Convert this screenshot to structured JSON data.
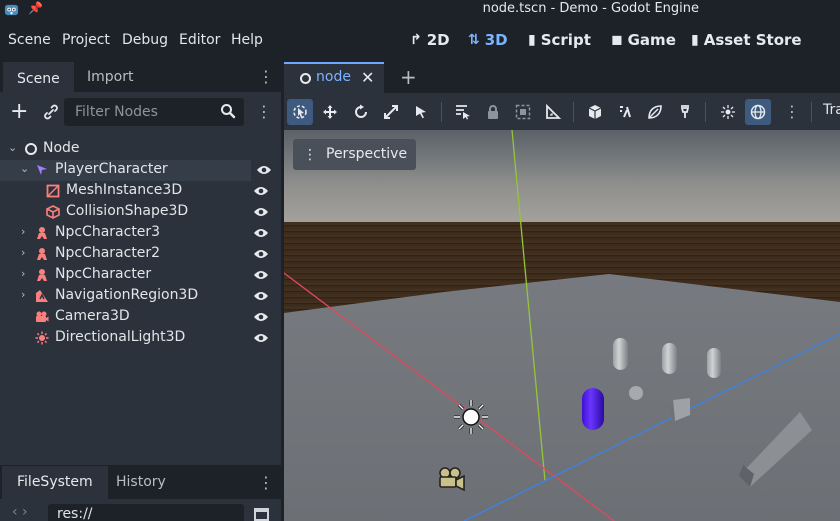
{
  "window": {
    "title": "node.tscn - Demo - Godot Engine"
  },
  "menu": [
    "Scene",
    "Project",
    "Debug",
    "Editor",
    "Help"
  ],
  "main_buttons": [
    {
      "label": "2D",
      "icon": "2d-icon",
      "active": false
    },
    {
      "label": "3D",
      "icon": "3d-icon",
      "active": true
    },
    {
      "label": "Script",
      "icon": "script-icon",
      "active": false
    },
    {
      "label": "Game",
      "icon": "game-icon",
      "active": false
    },
    {
      "label": "Asset Store",
      "icon": "asset-store-icon",
      "active": false
    }
  ],
  "scene_dock": {
    "tabs": [
      "Scene",
      "Import"
    ],
    "filter_placeholder": "Filter Nodes",
    "tree": [
      {
        "label": "Node",
        "icon": "node-icon",
        "expanded": true
      },
      {
        "label": "PlayerCharacter",
        "icon": "character-body-icon",
        "expanded": true,
        "selected": true
      },
      {
        "label": "MeshInstance3D",
        "icon": "mesh-instance-icon"
      },
      {
        "label": "CollisionShape3D",
        "icon": "collision-shape-icon"
      },
      {
        "label": "NpcCharacter3",
        "icon": "scene-instance-icon",
        "expanded": false
      },
      {
        "label": "NpcCharacter2",
        "icon": "scene-instance-icon",
        "expanded": false
      },
      {
        "label": "NpcCharacter",
        "icon": "scene-instance-icon",
        "expanded": false
      },
      {
        "label": "NavigationRegion3D",
        "icon": "navigation-region-icon",
        "expanded": false
      },
      {
        "label": "Camera3D",
        "icon": "camera-icon"
      },
      {
        "label": "DirectionalLight3D",
        "icon": "light-icon"
      }
    ]
  },
  "filesystem_dock": {
    "tabs": [
      "FileSystem",
      "History"
    ],
    "path": "res://"
  },
  "editor": {
    "tab_label": "node",
    "toolbar_overflow_label": "Tra",
    "view_label": "Perspective"
  },
  "colors": {
    "accent": "#7ab3ff",
    "node3d_red": "#fc7f7f",
    "character_purple": "#a57cff",
    "x_axis": "#e0485a",
    "y_axis": "#94c53a",
    "z_axis": "#3c82e3"
  }
}
